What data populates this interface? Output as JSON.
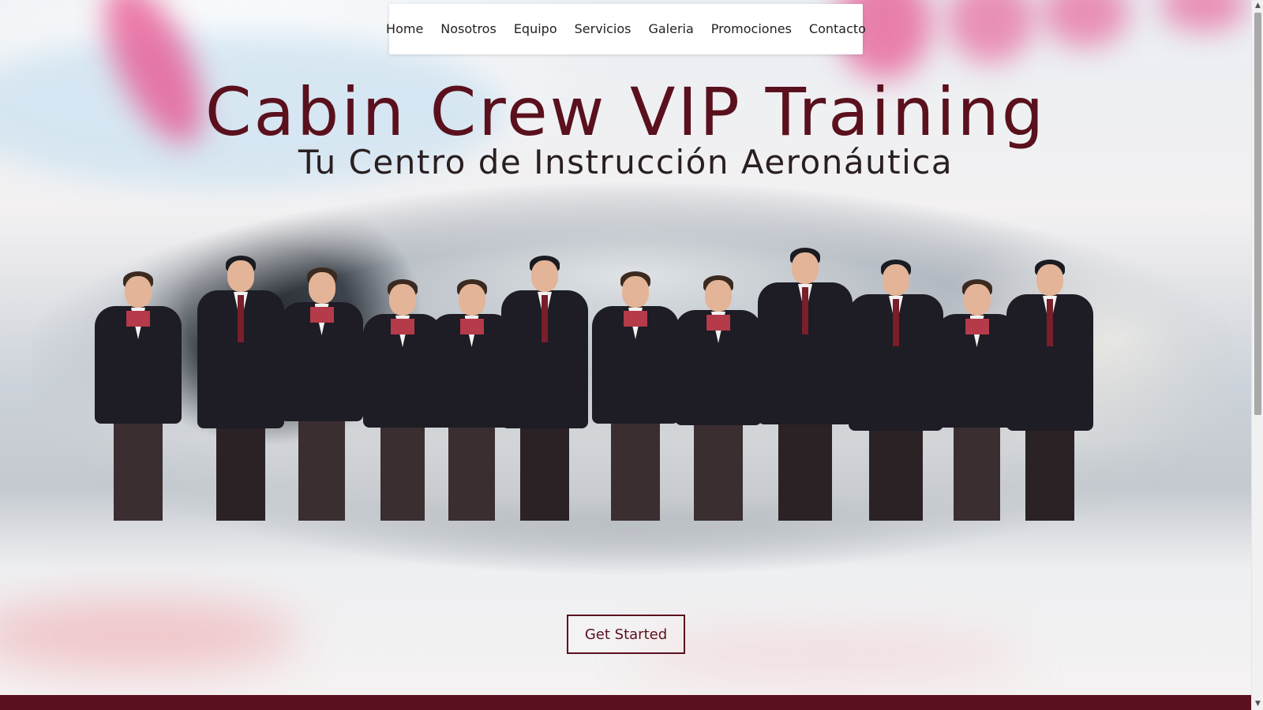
{
  "nav": {
    "items": [
      "Home",
      "Nosotros",
      "Equipo",
      "Servicios",
      "Galeria",
      "Promociones",
      "Contacto"
    ]
  },
  "hero": {
    "title": "Cabin Crew VIP Training",
    "subtitle": "Tu Centro de Instrucción Aeronáutica",
    "cta_label": "Get Started"
  },
  "colors": {
    "brand": "#5a111d",
    "accent_pink": "#e8518e"
  },
  "icons": {
    "scroll_up": "triangle-up-icon",
    "scroll_down": "triangle-down-icon"
  }
}
